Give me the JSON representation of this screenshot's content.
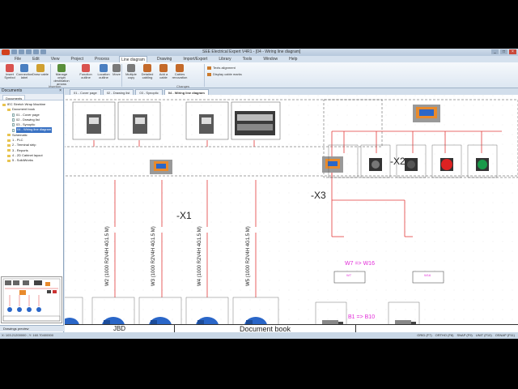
{
  "window": {
    "title": "SEE Electrical Expert V4R1 - [04 - Wiring line diagram]",
    "controls": [
      "_",
      "□",
      "×"
    ]
  },
  "ribbon": {
    "tabs": [
      "File",
      "Edit",
      "View",
      "Project",
      "Process",
      "Line diagram",
      "Drawing",
      "Import/Export",
      "Library",
      "Tools",
      "Window",
      "Help"
    ],
    "active_tab": "Line diagram",
    "buttons": [
      {
        "label": "Insert Symbol",
        "icon": "symbol-icon",
        "color": "#d9534f"
      },
      {
        "label": "Connection label",
        "icon": "connection-icon",
        "color": "#4a7fc1"
      },
      {
        "label": "Draw cable",
        "icon": "cable-icon",
        "color": "#d0a030"
      },
      {
        "label": "Manage origin destination arrows",
        "icon": "arrows-icon",
        "color": "#5a8f3a"
      },
      {
        "label": "Function outline",
        "icon": "function-icon",
        "color": "#d9534f"
      },
      {
        "label": "Location outline",
        "icon": "location-icon",
        "color": "#4a7fc1"
      },
      {
        "label": "Move",
        "icon": "move-icon",
        "color": "#7a7a7a"
      },
      {
        "label": "Multiple copy",
        "icon": "copy-icon",
        "color": "#7a7a7a"
      },
      {
        "label": "Detailed cabling",
        "icon": "detailed-cabling-icon",
        "color": "#c46a2a"
      },
      {
        "label": "Add a cable",
        "icon": "add-cable-icon",
        "color": "#c46a2a"
      },
      {
        "label": "Cables renovation",
        "icon": "renovation-icon",
        "color": "#c46a2a"
      }
    ],
    "groups": [
      "Insertion",
      "Changes"
    ],
    "side_options": [
      "Texts alignment",
      "Display cable marks"
    ]
  },
  "left_panel": {
    "title": "Documents",
    "tabs": [
      "Documents"
    ],
    "tree": [
      {
        "label": "IEC Stretch Wrap Machine",
        "type": "folder",
        "indent": 0
      },
      {
        "label": "Document book",
        "type": "folder",
        "indent": 1
      },
      {
        "label": "01 - Cover page",
        "type": "page",
        "indent": 2
      },
      {
        "label": "02 - Drawing list",
        "type": "page",
        "indent": 2
      },
      {
        "label": "03 - Synoptic",
        "type": "page",
        "indent": 2
      },
      {
        "label": "04 - Wiring line diagram",
        "type": "page",
        "indent": 2,
        "selected": true
      },
      {
        "label": "Schematic",
        "type": "folder",
        "indent": 1
      },
      {
        "label": "1 - PLC",
        "type": "folder",
        "indent": 1
      },
      {
        "label": "2 - Terminal strip",
        "type": "folder",
        "indent": 1
      },
      {
        "label": "3 - Reports",
        "type": "folder",
        "indent": 1
      },
      {
        "label": "4 - 2D Cabinet layout",
        "type": "folder",
        "indent": 1
      },
      {
        "label": "5 - SolidWorks",
        "type": "folder",
        "indent": 1
      }
    ],
    "preview_tab": "Drawings preview"
  },
  "doc_tabs": [
    {
      "label": "01 - Cover page",
      "active": false
    },
    {
      "label": "02 - Drawing list",
      "active": false
    },
    {
      "label": "03 - Synoptic",
      "active": false
    },
    {
      "label": "04 - Wiring line diagram",
      "active": true
    }
  ],
  "canvas": {
    "labels": {
      "x1": "-X1",
      "x2": "-X2",
      "x3": "-X3",
      "w7_w16": "W7 => W16",
      "b1_b10": "B1 => B10",
      "w7_box": "W7",
      "w16_box": "W16"
    },
    "cables": [
      "W2 (1000 R2V4H 4G1.5 M)",
      "W3 (1000 R2V4H 4G1.5 M)",
      "W4 (1000 R2V4H 4G1.5 M)",
      "W5 (1000 R2V4H 4G1.5 M)"
    ]
  },
  "title_block": {
    "author": "JBD",
    "doc_name": "Document book"
  },
  "status_bar": {
    "coords": "X: 103.21200000 ; Y: 160.70400000",
    "modes": [
      "GRID (F7)",
      "ORTHO (F8)",
      "SNAP (F9)",
      "UNIT (F10)",
      "OSNAP (F11)"
    ]
  },
  "colors": {
    "accent": "#3b73c4",
    "wire": "#e23a3a",
    "magenta": "#e22ad8",
    "motor": "#2a66c8"
  }
}
